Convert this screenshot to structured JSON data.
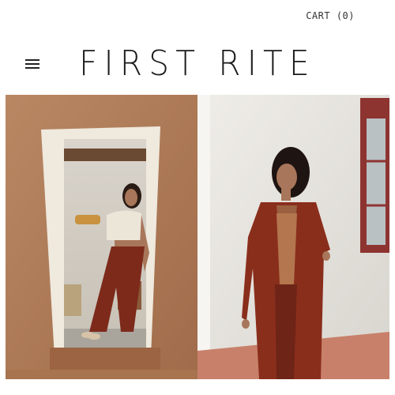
{
  "header": {
    "cart_label": "CART (0)",
    "logo_text": "FIRST RITE",
    "menu_icon": "hamburger-menu-icon"
  },
  "hero": {
    "images": [
      {
        "name": "hero-image-left",
        "description_icon": "model-in-doorway-photo"
      },
      {
        "name": "hero-image-right",
        "description_icon": "model-in-rust-coat-photo"
      }
    ]
  },
  "colors": {
    "background": "#ffffff",
    "text": "#1a1a1a",
    "adobe_wall": "#b5805e",
    "rust": "#8a2e1c",
    "white_wall": "#e8e6e1"
  }
}
